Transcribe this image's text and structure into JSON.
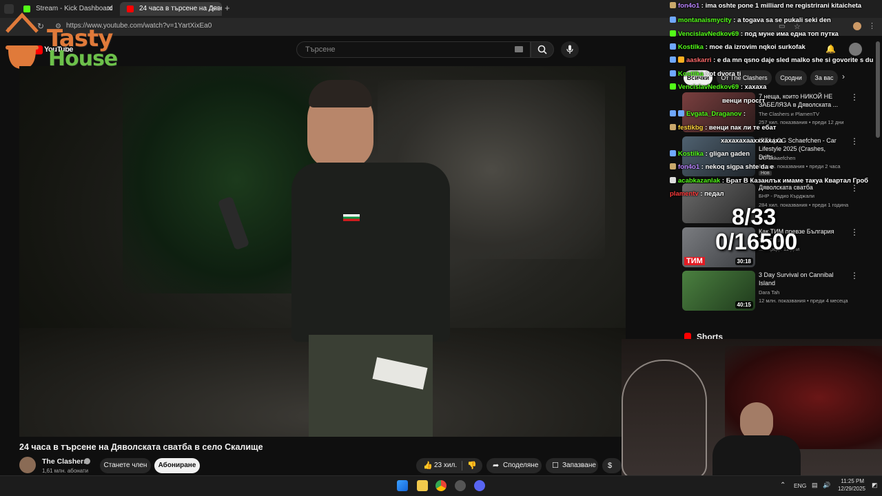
{
  "browser": {
    "tabs": [
      {
        "label": "Stream - Kick Dashboard",
        "color": "#53fc18"
      },
      {
        "label": "24 часа в търсене на Дяволск...",
        "color": "#ff0000"
      }
    ],
    "url": "https://www.youtube.com/watch?v=1YartXixEa0"
  },
  "overlay_logo": {
    "line1": "Tasty",
    "line2": "House"
  },
  "youtube": {
    "logo": "YouTube",
    "search_placeholder": "Търсене",
    "video_title": "24 часа в търсене на Дяволската сватба в село Скалище",
    "channel": {
      "name": "The Clashers",
      "subscribers": "1,61 млн. абонати"
    },
    "join_label": "Станете член",
    "subscribe_label": "Абониране",
    "likes": "23 хил.",
    "share_label": "Споделяне",
    "save_label": "Запазване",
    "chips": [
      "Всички",
      "От The Clashers",
      "Сродни",
      "За вас"
    ],
    "shorts_label": "Shorts",
    "recommendations": [
      {
        "title": "7 неща, които НИКОЙ НЕ ЗАБЕЛЯЗА в Дяволската ...",
        "channel": "The Clashers и PlamenTV",
        "meta": "257 хил. показвания • преди 12 дни",
        "duration": "",
        "thumb": "#6a3b3b"
      },
      {
        "title": "IPTA | OG Schaefchen - Car Lifestyle 2025 (Crashes, Drifts...",
        "channel": "OG Schaefchen",
        "meta": "89 хил. показвания • преди 2 часа",
        "duration": "",
        "badge": "Нов",
        "thumb": "#3f4d5a"
      },
      {
        "title": "Дяволската сватба",
        "channel": "БНР - Радио Кърджали",
        "meta": "284 хил. показвания • преди 1 година",
        "duration": "",
        "thumb": "#4a4a4a"
      },
      {
        "title": "Как ТИМ превзе България",
        "channel": "The Clashers",
        "meta": "... • преди 12 дни",
        "duration": "30:18",
        "thumb": "#5b5e63"
      },
      {
        "title": "3 Day Survival on Cannibal Island",
        "channel": "Dara Tah",
        "meta": "12 млн. показвания • преди 4 месеца",
        "duration": "40:15",
        "thumb": "#3f6b3a"
      }
    ]
  },
  "chat": [
    {
      "user": "fon4o1",
      "msg": "ima oshte pone 1 milliard ne registrirani kitaicheta",
      "color": "#b983ff"
    },
    {
      "user": "montanaismycity",
      "msg": "a togava sa se pukali seki den",
      "color": "#53fc18"
    },
    {
      "user": "VencislavNedkov69",
      "msg": "под муне има една топ путка",
      "color": "#53fc18"
    },
    {
      "user": "Kostilka",
      "msg": "moe da izrovim nqkoi surkofak",
      "color": "#53fc18"
    },
    {
      "user": "aaskarri",
      "msg": "e da mn qsno daje sled malko she si govorite s du",
      "color": "#ff6b6b"
    },
    {
      "user": "Kostilka",
      "msg": "ot dvora ti",
      "color": "#53fc18"
    },
    {
      "user": "VencislavNedkov69",
      "msg": "хахаха",
      "color": "#53fc18"
    },
    {
      "user": "",
      "msg": "венци просгт",
      "color": "#ffffff"
    },
    {
      "user": "Evgata_Draganov",
      "msg": "",
      "color": "#53fc18"
    },
    {
      "user": "festikbg",
      "msg": "венци пак ли те ебат",
      "color": "#ffd43b"
    },
    {
      "user": "",
      "msg": "хахахахаахххахаха",
      "color": "#ffffff"
    },
    {
      "user": "Kostilka",
      "msg": "gligan gaden",
      "color": "#53fc18"
    },
    {
      "user": "fon4o1",
      "msg": "nekoq sigpa shte da e",
      "color": "#b983ff"
    },
    {
      "user": "acabkazanlak",
      "msg": "Брат В Казанлък имаме такуа Квартал Гроб",
      "color": "#53fc18"
    },
    {
      "user": "plamentv",
      "msg": "педал",
      "color": "#ff3b3b"
    }
  ],
  "goals": {
    "primary": "8/33",
    "secondary": "0/16500"
  },
  "taskbar": {
    "lang": "ENG",
    "time": "11:25 PM",
    "date": "12/29/2025"
  },
  "colors": {
    "accent_red": "#ff0000",
    "kick_green": "#53fc18"
  }
}
